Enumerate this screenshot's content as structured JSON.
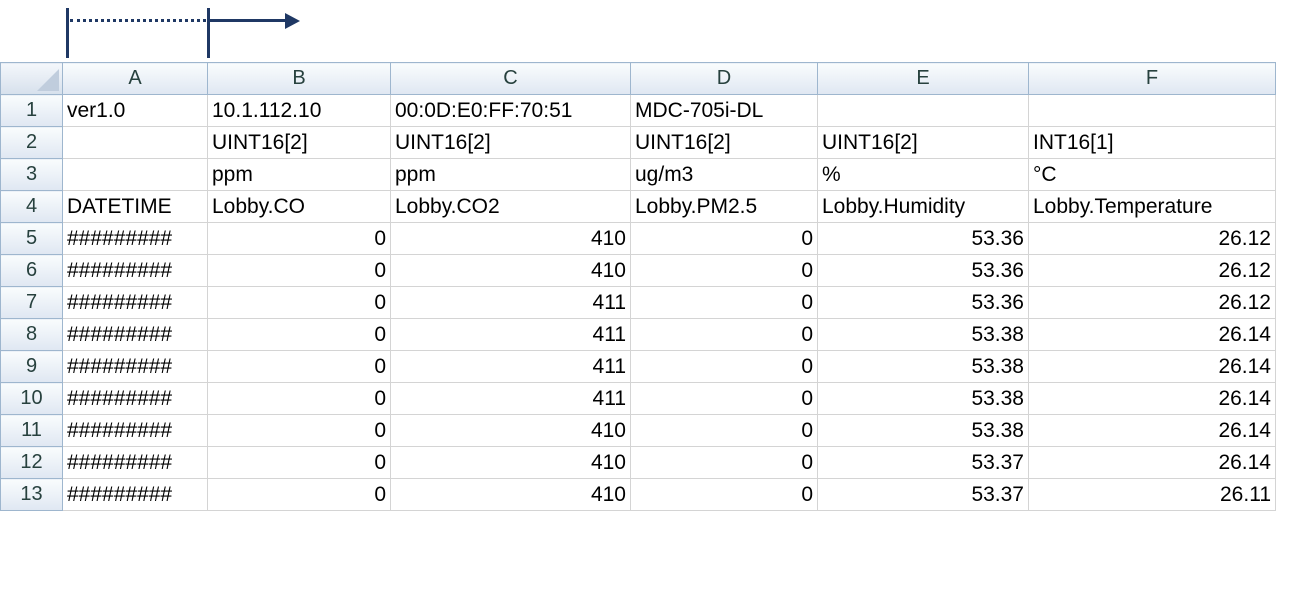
{
  "columns": [
    "A",
    "B",
    "C",
    "D",
    "E",
    "F"
  ],
  "rows": [
    {
      "num": "1",
      "cells": [
        "ver1.0",
        "10.1.112.10",
        "00:0D:E0:FF:70:51",
        "MDC-705i-DL",
        "",
        ""
      ]
    },
    {
      "num": "2",
      "cells": [
        "",
        "UINT16[2]",
        "UINT16[2]",
        "UINT16[2]",
        "UINT16[2]",
        "INT16[1]"
      ]
    },
    {
      "num": "3",
      "cells": [
        "",
        "ppm",
        "ppm",
        "ug/m3",
        "%",
        "°C"
      ]
    },
    {
      "num": "4",
      "cells": [
        "DATETIME",
        "Lobby.CO",
        "Lobby.CO2",
        "Lobby.PM2.5",
        "Lobby.Humidity",
        "Lobby.Temperature"
      ]
    },
    {
      "num": "5",
      "cells": [
        "#########",
        "0",
        "410",
        "0",
        "53.36",
        "26.12"
      ]
    },
    {
      "num": "6",
      "cells": [
        "#########",
        "0",
        "410",
        "0",
        "53.36",
        "26.12"
      ]
    },
    {
      "num": "7",
      "cells": [
        "#########",
        "0",
        "411",
        "0",
        "53.36",
        "26.12"
      ]
    },
    {
      "num": "8",
      "cells": [
        "#########",
        "0",
        "411",
        "0",
        "53.38",
        "26.14"
      ]
    },
    {
      "num": "9",
      "cells": [
        "#########",
        "0",
        "411",
        "0",
        "53.38",
        "26.14"
      ]
    },
    {
      "num": "10",
      "cells": [
        "#########",
        "0",
        "411",
        "0",
        "53.38",
        "26.14"
      ]
    },
    {
      "num": "11",
      "cells": [
        "#########",
        "0",
        "410",
        "0",
        "53.38",
        "26.14"
      ]
    },
    {
      "num": "12",
      "cells": [
        "#########",
        "0",
        "410",
        "0",
        "53.37",
        "26.14"
      ]
    },
    {
      "num": "13",
      "cells": [
        "#########",
        "0",
        "410",
        "0",
        "53.37",
        "26.11"
      ]
    }
  ],
  "colors": {
    "annotation": "#1f3864",
    "header_bg": "#dfe7f2",
    "gridline": "#d4d4d4"
  }
}
